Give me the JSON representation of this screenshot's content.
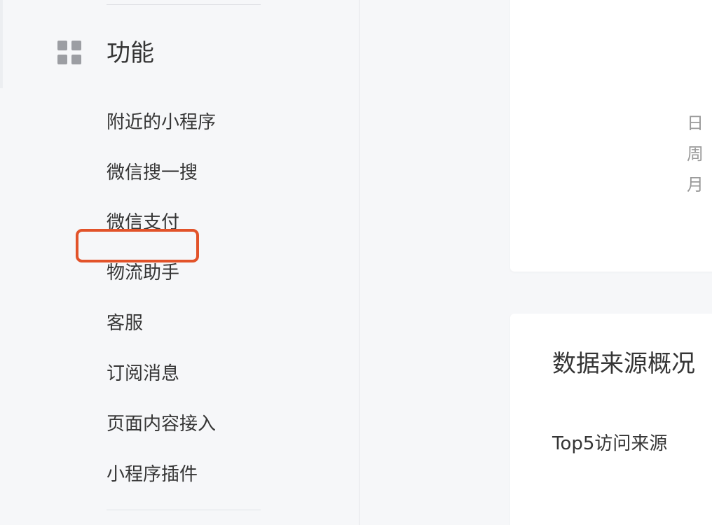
{
  "sidebar": {
    "section_title": "功能",
    "section_icon": "grid-icon",
    "items": [
      {
        "label": "附近的小程序"
      },
      {
        "label": "微信搜一搜"
      },
      {
        "label": "微信支付"
      },
      {
        "label": "物流助手"
      },
      {
        "label": "客服"
      },
      {
        "label": "订阅消息"
      },
      {
        "label": "页面内容接入"
      },
      {
        "label": "小程序插件"
      }
    ]
  },
  "main": {
    "periods": [
      "日",
      "周",
      "月"
    ],
    "source_card": {
      "title": "数据来源概况",
      "subtitle": "Top5访问来源"
    }
  },
  "colors": {
    "highlight_border": "#e2532a",
    "sidebar_bg": "#f6f7f9",
    "text": "#353535",
    "muted_text": "#9a9a9a"
  }
}
